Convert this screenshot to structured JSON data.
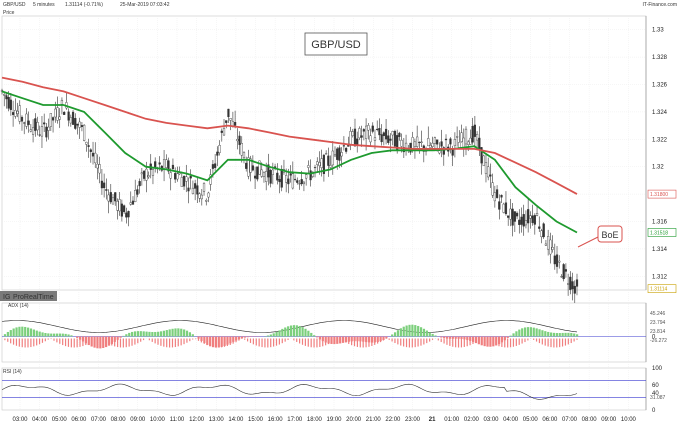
{
  "header": {
    "symbol": "GBP/USD",
    "timeframe": "5 minutes",
    "last": "1.31114 (-0.71%)",
    "datetime": "25-Mar-2019 07:03:42",
    "provider": "IT-Finance.com",
    "legend": "Price"
  },
  "chart_title": "GBP/USD",
  "callout": "BoE",
  "watermark": "ProRealTime",
  "colors": {
    "candle": "#333333",
    "ma_fast": "#1e9a2e",
    "ma_slow": "#d9534f",
    "callout": "#d9534f",
    "volume_pos": "#7ccf7c",
    "volume_neg": "#f07f7f",
    "rsi": "#333333",
    "rsi_levels": "#3a3ad0"
  },
  "price_panel": {
    "y_ticks": [
      "1.33",
      "1.328",
      "1.326",
      "1.324",
      "1.322",
      "1.32",
      "1.318",
      "1.316",
      "1.314",
      "1.312"
    ],
    "tags": [
      {
        "label": "1.31800",
        "value": 1.318,
        "color": "#d9534f"
      },
      {
        "label": "1.31518",
        "value": 1.3152,
        "color": "#1e9a2e"
      },
      {
        "label": "1.31114",
        "value": 1.3111,
        "color": "#c9a000"
      }
    ]
  },
  "macd_panel": {
    "label": "ADX (14)",
    "y_ticks": [
      "0"
    ],
    "tags": [
      "45.246",
      "23.794",
      "23.814",
      "-26.272"
    ]
  },
  "rsi_panel": {
    "label": "RSI (14)",
    "y_ticks": [
      "100",
      "60",
      "40",
      "0"
    ],
    "tags": [
      "31.087"
    ],
    "levels": [
      70,
      30
    ]
  },
  "x_axis": {
    "labels": [
      "03:00",
      "04:00",
      "05:00",
      "06:00",
      "07:00",
      "08:00",
      "09:00",
      "10:00",
      "11:00",
      "12:00",
      "13:00",
      "14:00",
      "15:00",
      "16:00",
      "17:00",
      "18:00",
      "19:00",
      "20:00",
      "21:00",
      "22:00",
      "23:00",
      "21",
      "01:00",
      "02:00",
      "03:00",
      "04:00",
      "05:00",
      "06:00",
      "07:00",
      "08:00",
      "09:00",
      "10:00"
    ]
  },
  "chart_data": {
    "type": "line",
    "x": [
      "03:00",
      "04:00",
      "05:00",
      "06:00",
      "07:00",
      "08:00",
      "09:00",
      "10:00",
      "11:00",
      "12:00",
      "13:00",
      "14:00",
      "15:00",
      "16:00",
      "17:00",
      "18:00",
      "19:00",
      "20:00",
      "21:00",
      "22:00",
      "23:00",
      "00:00",
      "01:00",
      "02:00",
      "03:00",
      "04:00",
      "05:00",
      "06:00",
      "07:00"
    ],
    "series": [
      {
        "values": [
          1.3255,
          1.3235,
          1.3225,
          1.3245,
          1.3225,
          1.3185,
          1.3165,
          1.3195,
          1.32,
          1.319,
          1.318,
          1.324,
          1.32,
          1.3195,
          1.319,
          1.3195,
          1.3205,
          1.322,
          1.3225,
          1.322,
          1.3215,
          1.3215,
          1.3215,
          1.3225,
          1.318,
          1.316,
          1.3165,
          1.313,
          1.3111
        ]
      },
      {
        "values": [
          1.3255,
          1.325,
          1.3245,
          1.3245,
          1.324,
          1.3225,
          1.321,
          1.32,
          1.3198,
          1.3195,
          1.319,
          1.3205,
          1.3205,
          1.32,
          1.3196,
          1.3195,
          1.3198,
          1.3205,
          1.321,
          1.3212,
          1.3212,
          1.3212,
          1.3213,
          1.3215,
          1.3205,
          1.3185,
          1.3172,
          1.316,
          1.3152
        ]
      },
      {
        "values": [
          1.3265,
          1.3262,
          1.3258,
          1.3255,
          1.325,
          1.3245,
          1.324,
          1.3235,
          1.3232,
          1.323,
          1.3228,
          1.323,
          1.3228,
          1.3225,
          1.3222,
          1.322,
          1.3218,
          1.3216,
          1.3215,
          1.3214,
          1.3213,
          1.3213,
          1.3213,
          1.3213,
          1.321,
          1.3203,
          1.3196,
          1.3188,
          1.318
        ]
      }
    ],
    "ylim": [
      1.311,
      1.331
    ],
    "grid": true
  }
}
